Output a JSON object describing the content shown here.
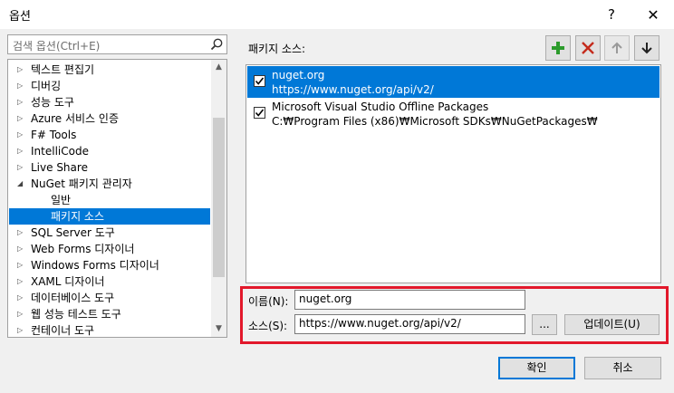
{
  "window": {
    "title": "옵션",
    "help_label": "?",
    "close_label": "✕"
  },
  "search": {
    "placeholder": "검색 옵션(Ctrl+E)"
  },
  "tree": {
    "items": [
      {
        "label": "텍스트 편집기",
        "arrow": "▷",
        "selected": false
      },
      {
        "label": "디버깅",
        "arrow": "▷",
        "selected": false
      },
      {
        "label": "성능 도구",
        "arrow": "▷",
        "selected": false
      },
      {
        "label": "Azure 서비스 인증",
        "arrow": "▷",
        "selected": false
      },
      {
        "label": "F# Tools",
        "arrow": "▷",
        "selected": false
      },
      {
        "label": "IntelliCode",
        "arrow": "▷",
        "selected": false
      },
      {
        "label": "Live Share",
        "arrow": "▷",
        "selected": false
      },
      {
        "label": "NuGet 패키지 관리자",
        "arrow": "◢",
        "selected": false
      },
      {
        "label": "일반",
        "arrow": "",
        "selected": false
      },
      {
        "label": "패키지 소스",
        "arrow": "",
        "selected": true
      },
      {
        "label": "SQL Server 도구",
        "arrow": "▷",
        "selected": false
      },
      {
        "label": "Web Forms 디자이너",
        "arrow": "▷",
        "selected": false
      },
      {
        "label": "Windows Forms 디자이너",
        "arrow": "▷",
        "selected": false
      },
      {
        "label": "XAML 디자이너",
        "arrow": "▷",
        "selected": false
      },
      {
        "label": "데이터베이스 도구",
        "arrow": "▷",
        "selected": false
      },
      {
        "label": "웹 성능 테스트 도구",
        "arrow": "▷",
        "selected": false
      },
      {
        "label": "컨테이너 도구",
        "arrow": "▷",
        "selected": false
      }
    ]
  },
  "sources": {
    "heading": "패키지 소스:",
    "items": [
      {
        "name": "nuget.org",
        "url": "https://www.nuget.org/api/v2/",
        "checked": true,
        "selected": true
      },
      {
        "name": "Microsoft Visual Studio Offline Packages",
        "url": "C:₩Program Files (x86)₩Microsoft SDKs₩NuGetPackages₩",
        "checked": true,
        "selected": false
      }
    ]
  },
  "details": {
    "name_label": "이름(N):",
    "name_value": "nuget.org",
    "source_label": "소스(S):",
    "source_value": "https://www.nuget.org/api/v2/",
    "browse_label": "...",
    "update_label": "업데이트(U)"
  },
  "footer": {
    "ok_label": "확인",
    "cancel_label": "취소"
  },
  "colors": {
    "selection": "#0078d7",
    "highlight_border": "#e2182b",
    "add_icon": "#2c9b2c",
    "remove_icon": "#c42b1c"
  }
}
